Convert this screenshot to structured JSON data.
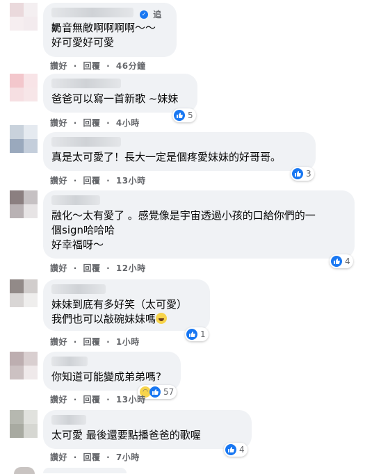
{
  "actions": {
    "like": "讚好",
    "reply": "回覆",
    "separator": "·"
  },
  "header": {
    "follow": "追蹤"
  },
  "comments": [
    {
      "text": "奶音無敵啊啊啊啊～～\n好可愛好可愛",
      "time": "46分鐘",
      "reactions": ""
    },
    {
      "text": "爸爸可以寫一首新歌 ~妹妹",
      "time": "4小時",
      "reactions": "5"
    },
    {
      "text": "真是太可愛了！長大一定是個疼愛妹妹的好哥哥。",
      "time": "13小時",
      "reactions": "3"
    },
    {
      "text": "融化～太有愛了 。感覺像是宇宙透過小孩的口給你們的一\n個sign哈哈哈\n好幸福呀～",
      "time": "12小時",
      "reactions": "4"
    },
    {
      "text": "妹妹到底有多好笑（太可愛）\n我們也可以敲碗妹妹嗎",
      "time": "1小時",
      "reactions": "1"
    },
    {
      "text": "你知道可能變成弟弟嗎?",
      "time": "13小時",
      "reactions": "57"
    },
    {
      "text": "太可愛 最後還要點播爸爸的歌喔",
      "time": "7小時",
      "reactions": "4"
    }
  ],
  "colors": {
    "like": "#1877f2",
    "bubble": "#f0f2f5",
    "meta": "#65676b"
  }
}
